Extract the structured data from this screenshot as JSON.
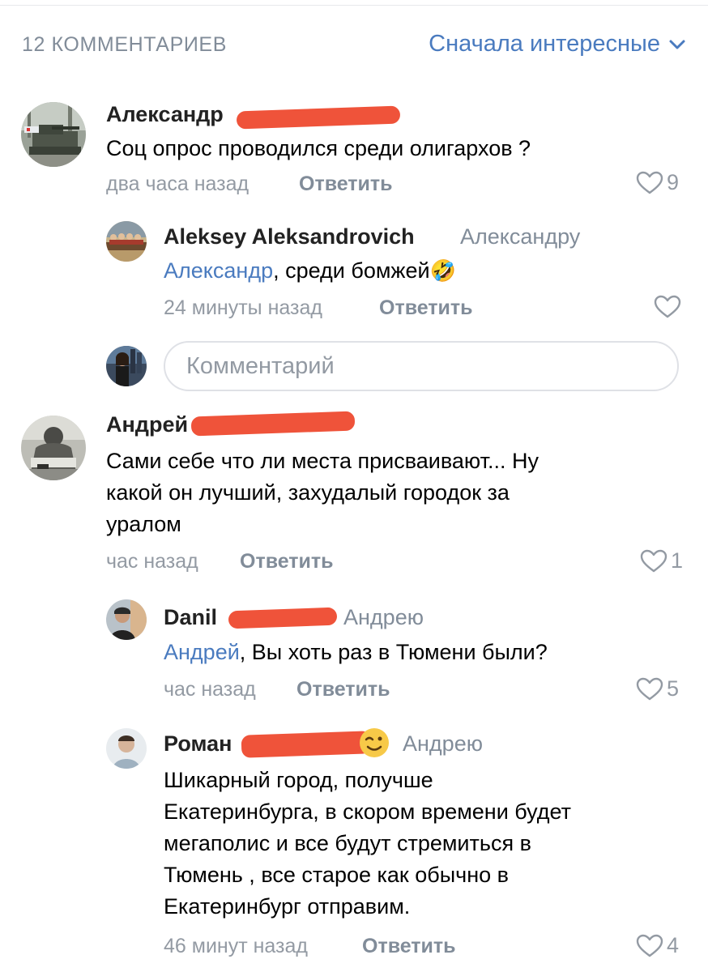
{
  "header": {
    "count_label": "12 КОММЕНТАРИЕВ",
    "sort_label": "Сначала интересные",
    "sort_icon": "chevron-down-icon"
  },
  "comments": [
    {
      "author": "Александр",
      "text": "Соц опрос проводился среди олигархов ?",
      "time": "два часа назад",
      "reply_label": "Ответить",
      "likes": "9"
    },
    {
      "author": "Aleksey Aleksandrovich",
      "reply_to": "Александру",
      "mention": "Александр",
      "text": ", среди бомжей",
      "emoji": "🤣",
      "time": "24 минуты назад",
      "reply_label": "Ответить",
      "likes": ""
    },
    {
      "author": "Андрей",
      "text_lines": [
        "Сами себе что ли места присваивают... Ну",
        "какой он лучший, захудалый городок за",
        "уралом"
      ],
      "time": "час назад",
      "reply_label": "Ответить",
      "likes": "1"
    },
    {
      "author": "Danil",
      "reply_to": "Андрею",
      "mention": "Андрей",
      "text": ", Вы хоть раз в Тюмени были?",
      "time": "час назад",
      "reply_label": "Ответить",
      "likes": "5"
    },
    {
      "author": "Роман",
      "reply_to": "Андрею",
      "text_lines": [
        "Шикарный город, получше",
        "Екатеринбурга, в скором времени будет",
        "мегаполис и все будут стремиться в",
        "Тюмень , все старое как обычно в",
        "Екатеринбург отправим."
      ],
      "time": "46 минут назад",
      "reply_label": "Ответить",
      "likes": "4"
    }
  ],
  "input": {
    "placeholder": "Комментарий"
  },
  "colors": {
    "link": "#4a7bbf",
    "secondary": "#818c99",
    "redaction": "#ee4a2f"
  }
}
